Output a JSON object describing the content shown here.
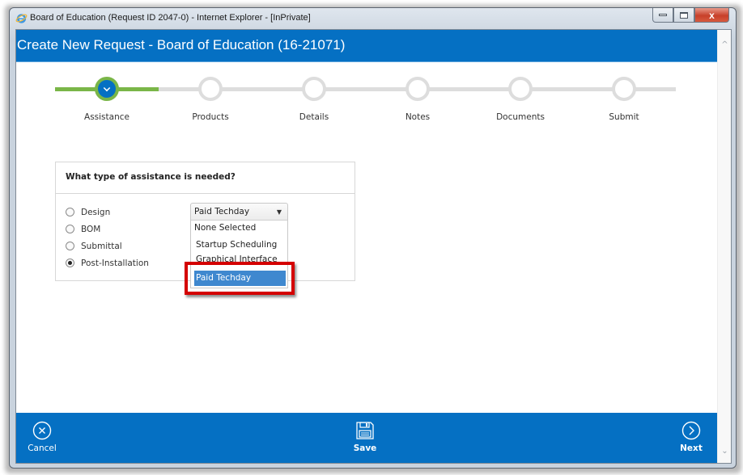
{
  "window": {
    "title": "Board of Education (Request ID 2047-0) - Internet Explorer - [InPrivate]",
    "close_glyph": "x"
  },
  "header": {
    "title": "Create New Request - Board of Education (16-21071)"
  },
  "stepper": {
    "current_step": 1,
    "steps": [
      {
        "label": "Assistance",
        "state": "active"
      },
      {
        "label": "Products",
        "state": "pending"
      },
      {
        "label": "Details",
        "state": "pending"
      },
      {
        "label": "Notes",
        "state": "pending"
      },
      {
        "label": "Documents",
        "state": "pending"
      },
      {
        "label": "Submit",
        "state": "pending"
      }
    ]
  },
  "question": {
    "title": "What type of assistance is needed?",
    "options": [
      {
        "label": "Design",
        "checked": false
      },
      {
        "label": "BOM",
        "checked": false
      },
      {
        "label": "Submittal",
        "checked": false
      },
      {
        "label": "Post-Installation",
        "checked": true
      }
    ],
    "select": {
      "value": "Paid Techday",
      "arrow": "▼",
      "options": [
        "None Selected",
        "Startup Scheduling",
        "Graphical Interface",
        "Paid Techday"
      ],
      "highlighted": "Paid Techday"
    }
  },
  "footer": {
    "cancel_label": "Cancel",
    "save_label": "Save",
    "next_label": "Next"
  },
  "colors": {
    "brand_blue": "#0570c3",
    "progress_green": "#7ab648",
    "track_gray": "#dddddd",
    "highlight_red": "#d40000",
    "option_selected": "#3f88cf"
  }
}
